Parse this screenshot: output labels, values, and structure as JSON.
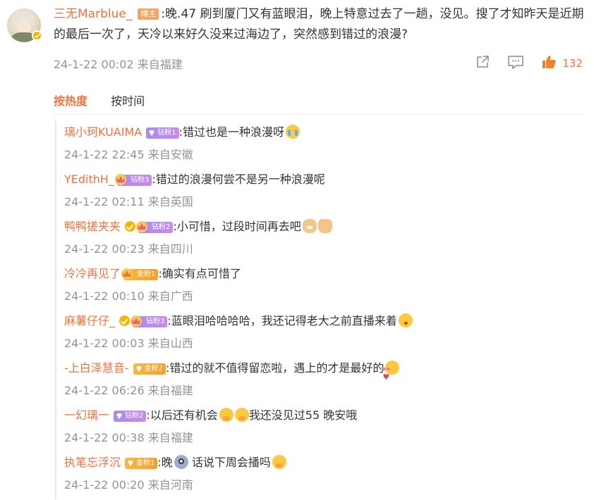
{
  "post": {
    "author": "三无Marblue_",
    "author_tag": "博主",
    "text": ":晚.47 刷到厦门又有蓝眼泪，晚上特意过去了一趟，没见。搜了才知昨天是近期的最后一次了，天冷以来好久没来过海边了，突然感到错过的浪漫?",
    "time": "24-1-22 00:02",
    "location": "来自福建",
    "like_count": "132"
  },
  "sort": {
    "hot": "按热度",
    "time": "按时间"
  },
  "replies": [
    {
      "name": "璃小珂KUAIMA",
      "badge": "钻粉1",
      "badge_type": "diamond",
      "text": ":错过也是一种浪漫呀",
      "emoji": [
        "cry"
      ],
      "time": "24-1-22 22:45",
      "location": "来自安徽"
    },
    {
      "name": "YEdithH_",
      "badge": "钻粉3",
      "badge_type": "diamond-crown",
      "text": ":错过的浪漫何尝不是另一种浪漫呢",
      "time": "24-1-22 02:11",
      "location": "来自英国"
    },
    {
      "name": "鸭鸭搓夹夹",
      "verified": true,
      "badge": "钻粉2",
      "badge_type": "diamond-crown",
      "text": ":小可惜，过段时间再去吧",
      "emoji": [
        "dog",
        "thumb"
      ],
      "time": "24-1-22 00:23",
      "location": "来自四川"
    },
    {
      "name": "冷冷再见了",
      "badge": "金粉1",
      "badge_type": "gold-crown",
      "text": ":确实有点可惜了",
      "time": "24-1-22 00:10",
      "location": "来自广西"
    },
    {
      "name": "麻薯仔仔_",
      "verified": true,
      "badge": "钻粉3",
      "badge_type": "diamond-crown",
      "text": ":蓝眼泪哈哈哈哈，我还记得老大之前直播来着",
      "emoji": [
        "kiss"
      ],
      "time": "24-1-22 00:03",
      "location": "来自山西"
    },
    {
      "name": "-上白泽慧音-",
      "badge": "金粉2",
      "badge_type": "gold",
      "text": ":错过的就不值得留恋啦，遇上的才是最好的",
      "emoji": [
        "heart"
      ],
      "time": "24-1-22 06:26",
      "location": "来自福建"
    },
    {
      "name": "一幻璃一",
      "badge": "钻粉2",
      "badge_type": "diamond",
      "text_a": ":以后还有机会",
      "text_b": "我还没见过55 晚安哦",
      "time": "24-1-22 00:38",
      "location": "来自福建"
    },
    {
      "name": "执笔忘浮沉",
      "badge": "金粉1",
      "badge_type": "gold",
      "text_a": ":晚",
      "text_b": " 话说下周会播吗",
      "time": "24-1-22 00:20",
      "location": "来自河南"
    }
  ]
}
